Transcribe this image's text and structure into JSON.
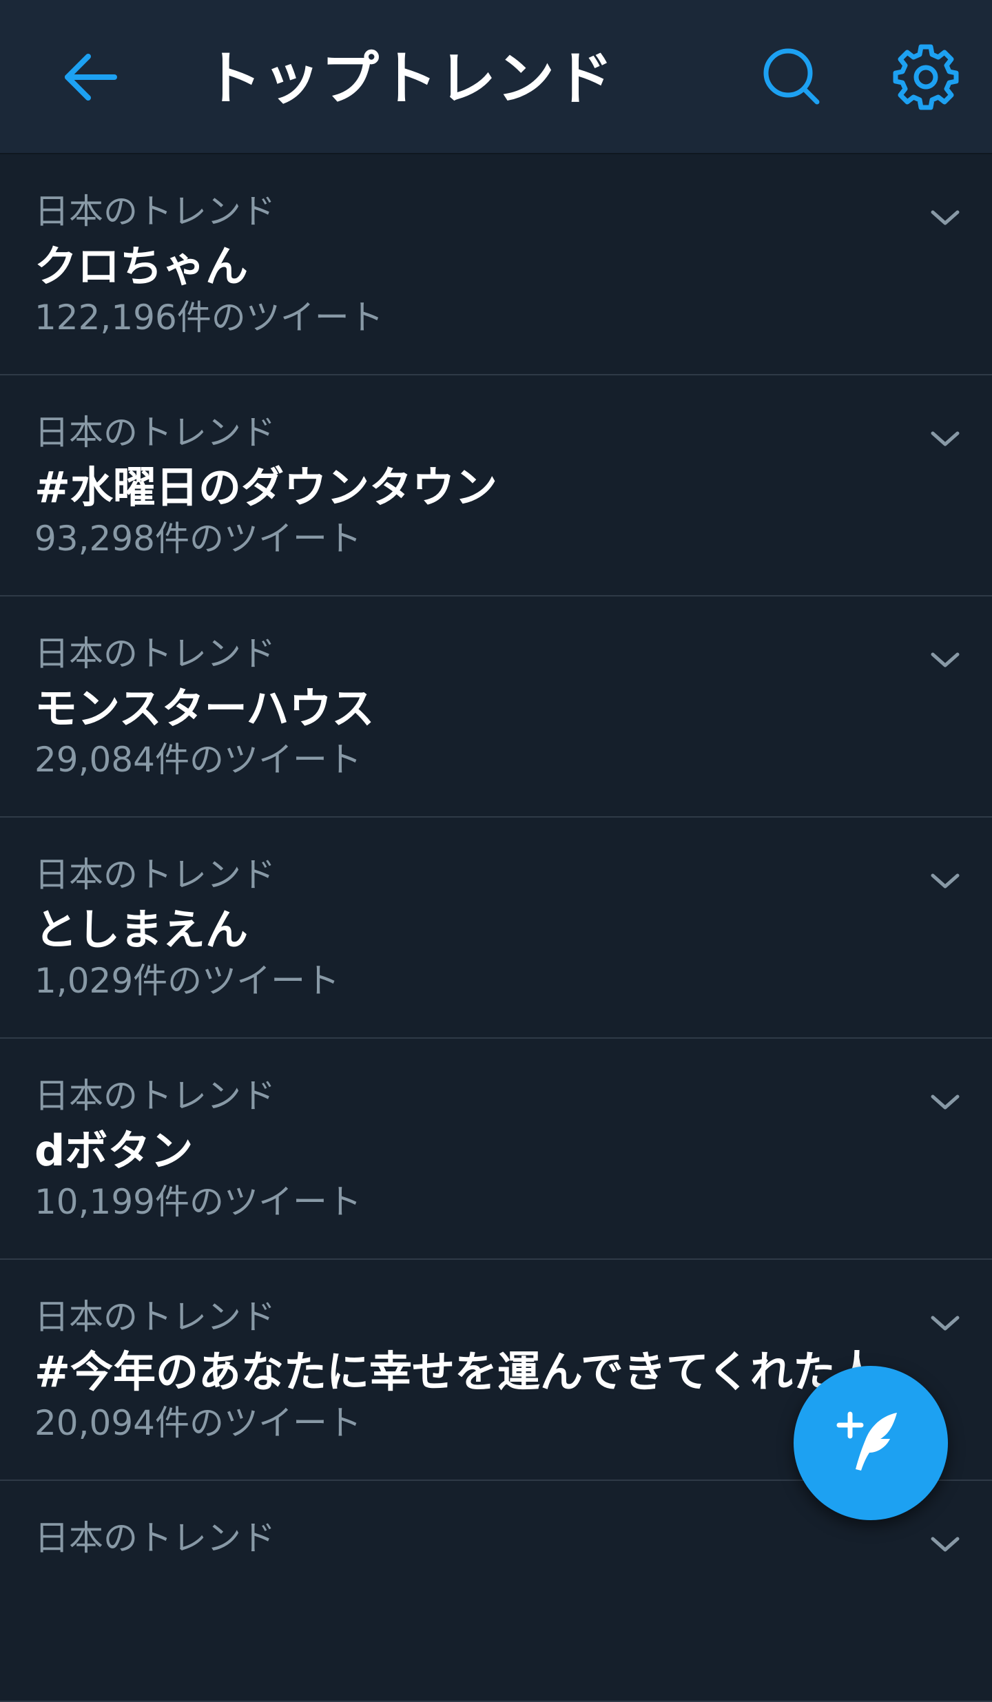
{
  "header": {
    "title": "トップトレンド",
    "back_icon": "back-arrow-icon",
    "search_icon": "search-icon",
    "settings_icon": "gear-icon",
    "accent_color": "#1da1f2",
    "background_color": "#1b2838"
  },
  "trends": [
    {
      "context": "日本のトレンド",
      "name": "クロちゃん",
      "count": "122,196件のツイート"
    },
    {
      "context": "日本のトレンド",
      "name": "#水曜日のダウンタウン",
      "count": "93,298件のツイート"
    },
    {
      "context": "日本のトレンド",
      "name": "モンスターハウス",
      "count": "29,084件のツイート"
    },
    {
      "context": "日本のトレンド",
      "name": "としまえん",
      "count": "1,029件のツイート"
    },
    {
      "context": "日本のトレンド",
      "name": "dボタン",
      "count": "10,199件のツイート"
    },
    {
      "context": "日本のトレンド",
      "name": "#今年のあなたに幸せを運んできてくれた人",
      "count": "20,094件のツイート"
    },
    {
      "context": "日本のトレンド",
      "name": "",
      "count": ""
    }
  ],
  "fab": {
    "icon": "compose-tweet-icon",
    "color": "#1da1f2"
  },
  "colors": {
    "page_background": "#151f2b",
    "primary_text": "#ffffff",
    "secondary_text": "#8899a6",
    "divider": "#2f3a47"
  }
}
